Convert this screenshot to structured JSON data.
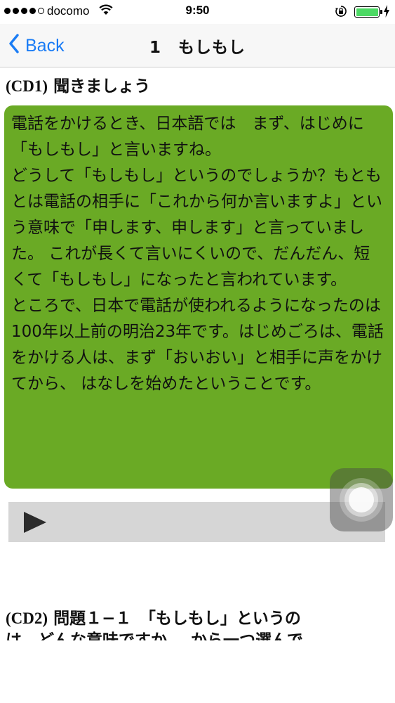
{
  "status_bar": {
    "carrier": "docomo",
    "time": "9:50",
    "signal_bars": 5,
    "signal_filled": 4,
    "battery_level": 1.0,
    "battery_color": "#4cd964"
  },
  "nav": {
    "back_label": "Back",
    "title": "1　もしもし",
    "accent_color": "#1a7cf5"
  },
  "section1": {
    "cd_label": "(CD1)",
    "heading": "聞きましょう",
    "body": "電話をかけるとき、日本語では　まず、はじめに「もしもし」と言いますね。\nどうして「もしもし」というのでしょうか？もともとは電話の相手に「これから何か言いますよ」という意味で「申します、申します」と言っていました。 これが長くて言いにくいので、だんだん、短くて「もしもし」になったと言われています。\nところで、日本で電話が使われるようになったのは　100年以上前の明治23年です。はじめごろは、電話をかける人は、まず「おいおい」と相手に声をかけてから、 はなしを始めたということです。",
    "card_color": "#6aaa25"
  },
  "player": {
    "play_icon": "play-icon"
  },
  "section2": {
    "cd_label": "(CD2)",
    "heading": "問題１−１　「もしもし」というの",
    "clipped_line": "は、どんな意味ですか。　から一つ選んで"
  }
}
